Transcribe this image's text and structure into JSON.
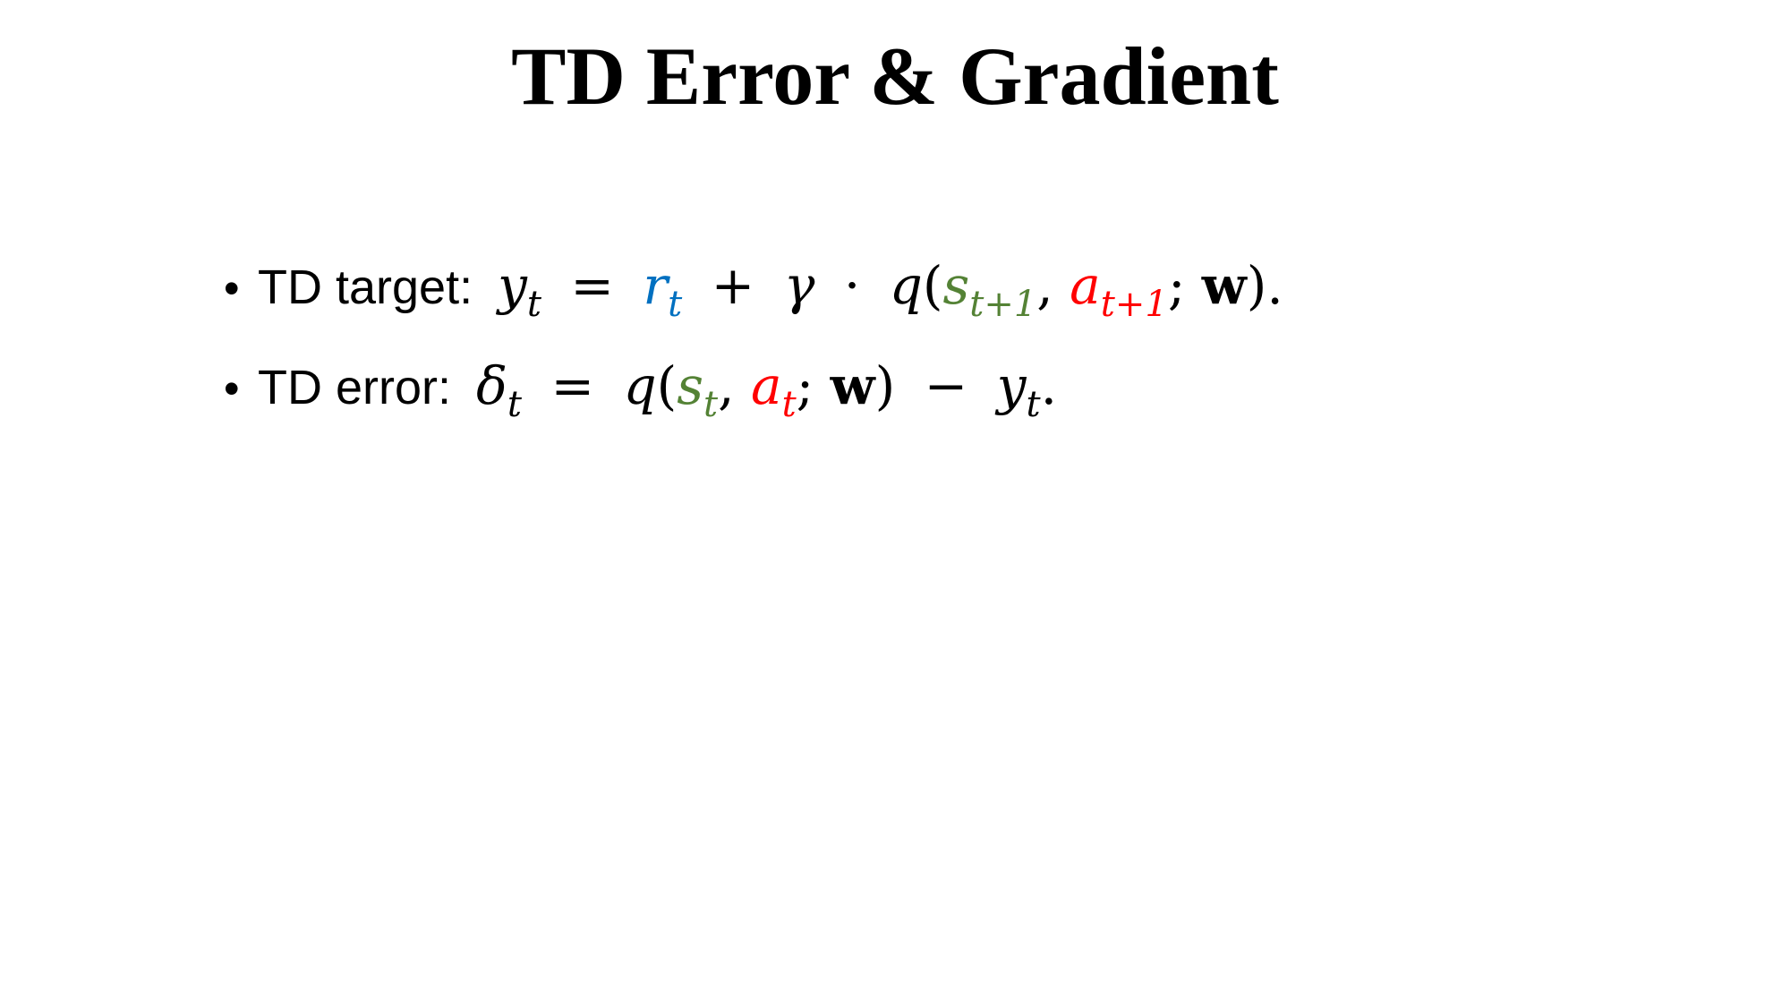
{
  "slide": {
    "title": "TD Error & Gradient"
  },
  "bullets": [
    {
      "marker": "•",
      "label": "TD target:",
      "formula": {
        "lhs": "y",
        "lhs_sub": "t",
        "eq": "=",
        "r": "r",
        "r_sub": "t",
        "plus": "+",
        "gamma": "γ",
        "dot": "·",
        "q": "q",
        "lparen": "(",
        "s": "s",
        "s_sub": "t+1",
        "comma": ",",
        "a": "a",
        "a_sub": "t+1",
        "semicolon": ";",
        "w": "w",
        "rparen": ")",
        "end": "."
      }
    },
    {
      "marker": "•",
      "label": "TD error:",
      "formula": {
        "lhs": "δ",
        "lhs_sub": "t",
        "eq": "=",
        "q": "q",
        "lparen": "(",
        "s": "s",
        "s_sub": "t",
        "comma": ",",
        "a": "a",
        "a_sub": "t",
        "semicolon": ";",
        "w": "w",
        "rparen": ")",
        "minus": "−",
        "y": "y",
        "y_sub": "t",
        "end": "."
      }
    }
  ],
  "colors": {
    "reward": "#0070C0",
    "state": "#548235",
    "action": "#FF0000",
    "text": "#000000"
  }
}
